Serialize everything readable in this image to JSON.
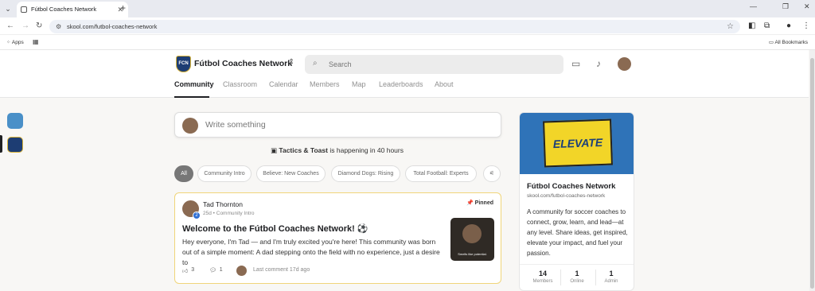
{
  "browser": {
    "tab_title": "Fútbol Coaches Network",
    "url": "skool.com/futbol-coaches-network",
    "bookmarks_apps": "Apps",
    "all_bookmarks": "All Bookmarks"
  },
  "header": {
    "logo_text": "FCN",
    "group_name": "Fútbol Coaches Network",
    "search_placeholder": "Search"
  },
  "nav": {
    "tabs": [
      "Community",
      "Classroom",
      "Calendar",
      "Members",
      "Map",
      "Leaderboards",
      "About"
    ],
    "active": "Community"
  },
  "composer": {
    "placeholder": "Write something"
  },
  "event_banner": {
    "name": "Tactics & Toast",
    "text": "is happening in 40 hours"
  },
  "filters": {
    "chips": [
      "All",
      "Community Intro",
      "Believe: New Coaches",
      "Diamond Dogs: Rising",
      "Total Football: Experts"
    ]
  },
  "post": {
    "author": "Tad Thornton",
    "level": "2",
    "time": "25d",
    "category": "Community Intro",
    "pinned_label": "Pinned",
    "title": "Welcome to the Fútbol Coaches Network! ⚽",
    "body": "Hey everyone, I'm Tad — and I'm truly excited you're here! This community was born out of a simple moment: A dad stepping onto the field with no experience, just a desire to",
    "thumb_caption": "Smells like potential.",
    "likes": "3",
    "comments": "1",
    "last_comment": "Last comment 17d ago"
  },
  "about_card": {
    "banner_text": "ELEVATE",
    "name": "Fútbol Coaches Network",
    "url": "skool.com/futbol-coaches-network",
    "description": "A community for soccer coaches to connect, grow, learn, and lead—at any level. Share ideas, get inspired, elevate your impact, and fuel your passion.",
    "stats": [
      {
        "value": "14",
        "label": "Members"
      },
      {
        "value": "1",
        "label": "Online"
      },
      {
        "value": "1",
        "label": "Admin"
      }
    ]
  },
  "colors": {
    "accent_gold": "#d9b43a",
    "brand_navy": "#1d3d73",
    "post_border": "#f0d57a"
  }
}
